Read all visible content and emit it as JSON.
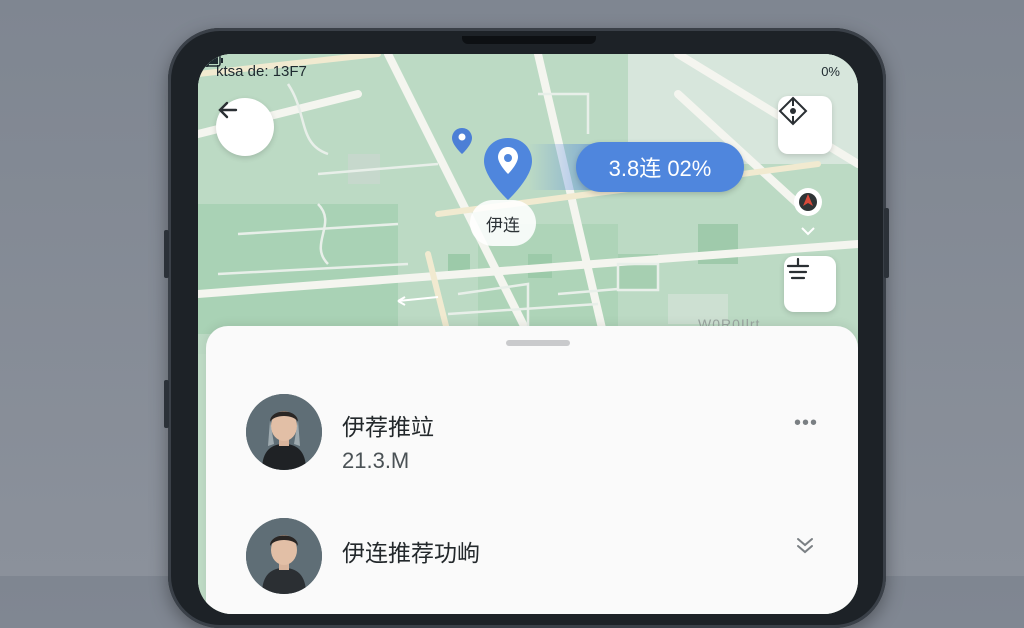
{
  "status_bar": {
    "left_text": "ktsa de: 13F7",
    "battery": "0%"
  },
  "map": {
    "location_label": "伊连",
    "distance_pill": "3.8连 02%",
    "street_watermark": "W0R0Ilrt"
  },
  "buttons": {
    "back": "back",
    "compass": "compass",
    "filter": "filter"
  },
  "sheet": {
    "items": [
      {
        "name": "伊荐推竝",
        "distance": "21.3.M",
        "action": "more"
      },
      {
        "name": "伊连推荐功岣",
        "action": "expand"
      }
    ]
  },
  "colors": {
    "accent": "#4f86dd",
    "map_green": "#bfdcc6",
    "pin_red": "#d94a3b",
    "sheet_bg": "#fafafa"
  }
}
